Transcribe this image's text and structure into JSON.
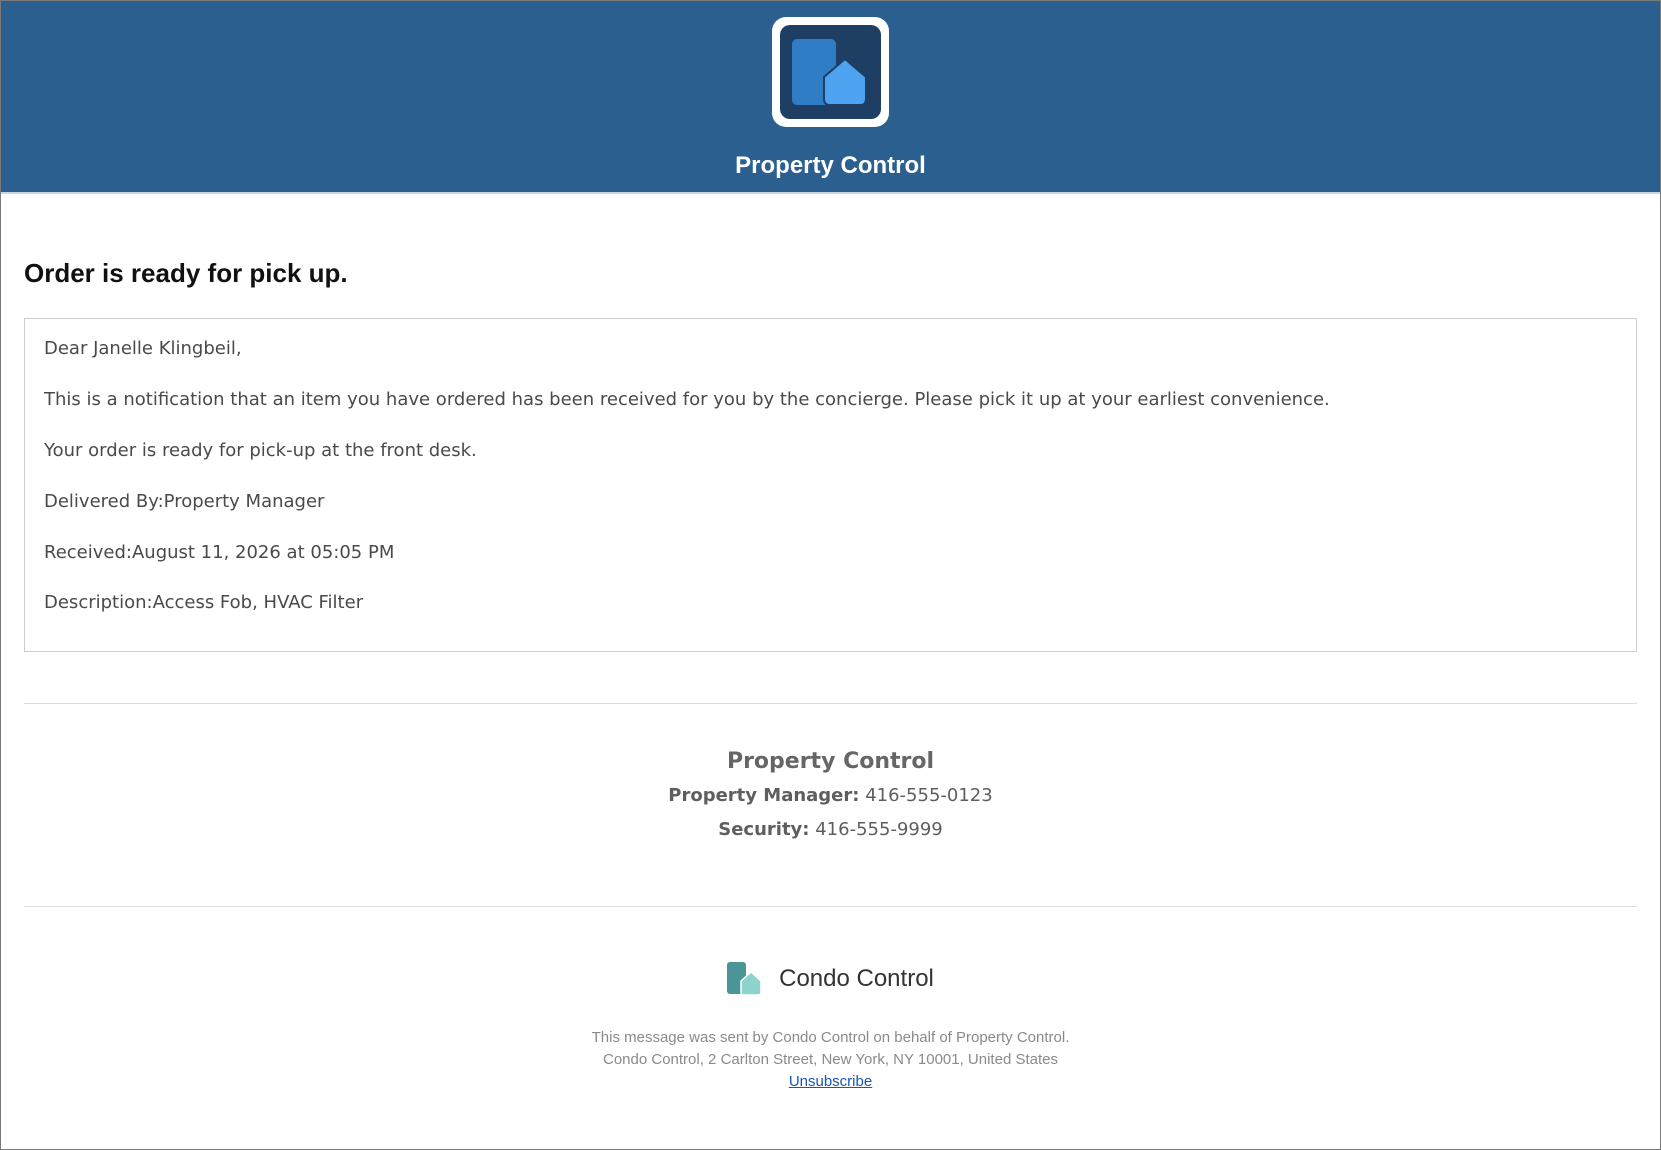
{
  "header": {
    "title": "Property Control",
    "logo_icon": "building-house-logo-icon",
    "background": "#2a5f8f"
  },
  "notification": {
    "title": "Order is ready for pick up.",
    "greeting": "Dear Janelle Klingbeil,",
    "intro": "This is a notification that an item you have ordered has been received for you by the concierge. Please pick it up at your earliest convenience.",
    "pickup_note": "Your order is ready for pick-up at the front desk.",
    "delivered_by_label": "Delivered By:",
    "delivered_by_value": "Property Manager",
    "received_label": "Received:",
    "received_value": "August 11, 2026 at 05:05 PM",
    "description_label": "Description:",
    "description_value": "Access Fob, HVAC Filter"
  },
  "signature": {
    "name": "Property Control",
    "contacts": [
      {
        "label": "Property Manager:",
        "value": "416-555-0123"
      },
      {
        "label": "Security:",
        "value": "416-555-9999"
      }
    ]
  },
  "footer": {
    "brand_name": "Condo Control",
    "brand_icon": "condo-control-logo-icon",
    "sent_by": "This message was sent by Condo Control on behalf of Property Control.",
    "address": "Condo Control, 2 Carlton Street, New York, NY 10001, United States",
    "unsubscribe_label": "Unsubscribe",
    "link_color": "#1a56b5"
  }
}
